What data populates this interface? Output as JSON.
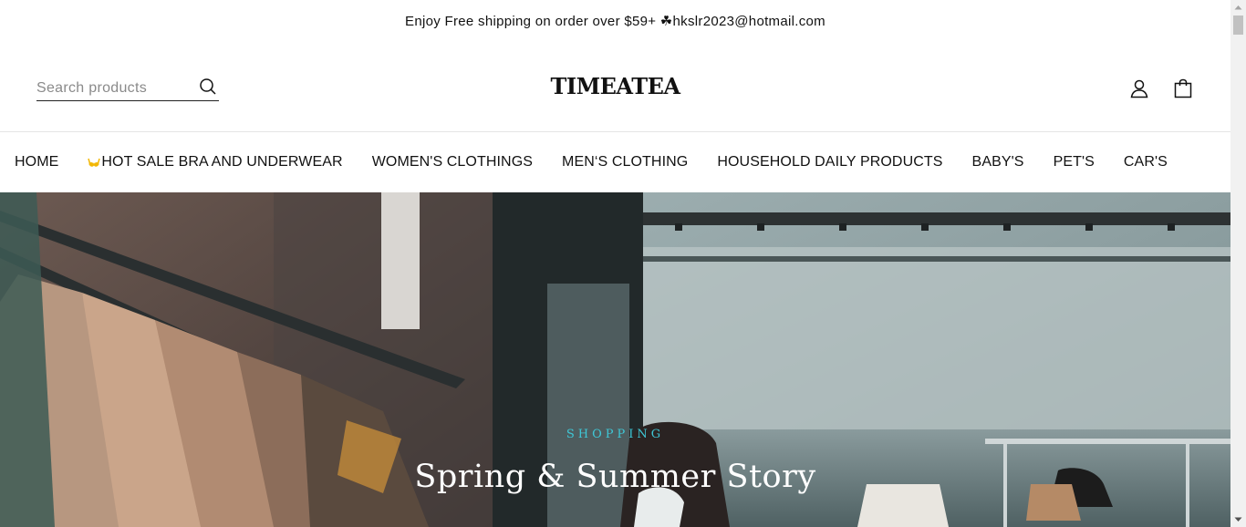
{
  "announcement": {
    "text": "Enjoy Free shipping on order over $59+ ☘hkslr2023@hotmail.com"
  },
  "header": {
    "search": {
      "placeholder": "Search products",
      "value": ""
    },
    "logo": "TIMEATEA"
  },
  "nav": {
    "items": [
      {
        "label": "HOME"
      },
      {
        "label": "HOT SALE BRA AND UNDERWEAR",
        "icon": "bra-icon"
      },
      {
        "label": "WOMEN'S CLOTHINGS"
      },
      {
        "label": "MEN‘S CLOTHING"
      },
      {
        "label": "HOUSEHOLD DAILY PRODUCTS"
      },
      {
        "label": "BABY'S"
      },
      {
        "label": "PET'S"
      },
      {
        "label": "CAR'S"
      }
    ]
  },
  "hero": {
    "subtitle": "SHOPPING",
    "title": "Spring & Summer Story"
  },
  "colors": {
    "accent": "#3fc7d6",
    "text": "#111111",
    "hero_overlay": "#6a7d80"
  }
}
